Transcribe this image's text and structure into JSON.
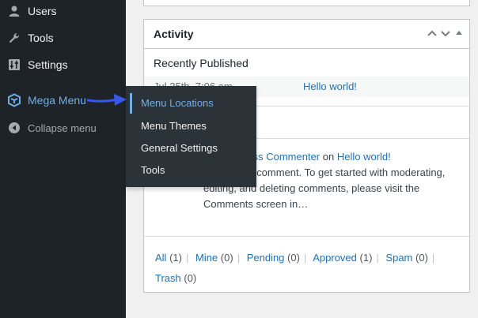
{
  "sidebar": {
    "items": [
      {
        "label": "Users",
        "icon": "users-icon"
      },
      {
        "label": "Tools",
        "icon": "wrench-icon"
      },
      {
        "label": "Settings",
        "icon": "settings-sliders-icon"
      },
      {
        "label": "Mega Menu",
        "icon": "mega-menu-cube-icon"
      },
      {
        "label": "Collapse menu",
        "icon": "collapse-arrow-icon"
      }
    ]
  },
  "flyout": {
    "items": [
      {
        "label": "Menu Locations"
      },
      {
        "label": "Menu Themes"
      },
      {
        "label": "General Settings"
      },
      {
        "label": "Tools"
      }
    ]
  },
  "activity": {
    "title": "Activity",
    "recently_published": "Recently Published",
    "post_date": "Jul 25th, 7:06 am",
    "post_link": "Hello world!",
    "comment_author": "A WordPress Commenter",
    "comment_on": "on",
    "comment_post": "Hello world!",
    "comment_text": "Hi, this is a comment. To get started with moderating, editing, and deleting comments, please visit the Comments screen in…",
    "filters": [
      {
        "label": "All",
        "count": "(1)"
      },
      {
        "label": "Mine",
        "count": "(0)"
      },
      {
        "label": "Pending",
        "count": "(0)"
      },
      {
        "label": "Approved",
        "count": "(1)"
      },
      {
        "label": "Spam",
        "count": "(0)"
      },
      {
        "label": "Trash",
        "count": "(0)"
      }
    ]
  },
  "colors": {
    "sidebar_bg": "#1d2327",
    "flyout_bg": "#2c3338",
    "accent": "#72aee6",
    "link": "#2271b1",
    "arrow": "#3858e9"
  }
}
